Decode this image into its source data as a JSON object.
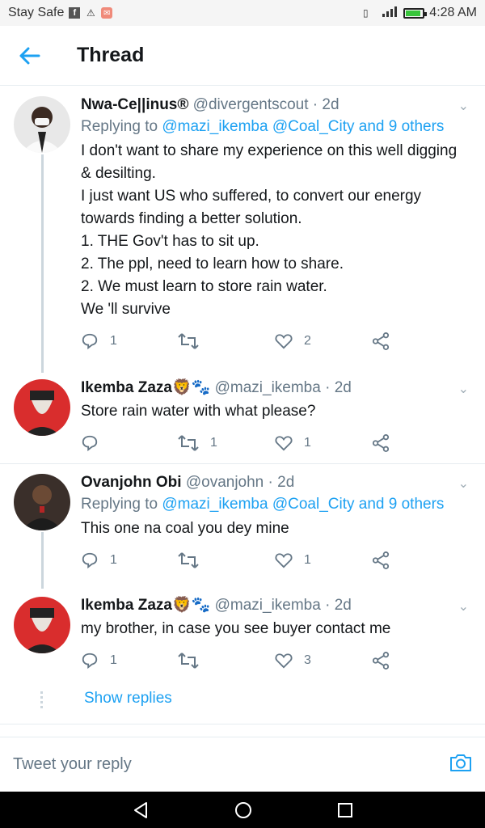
{
  "statusbar": {
    "left_text": "Stay Safe",
    "time": "4:28 AM"
  },
  "header": {
    "title": "Thread"
  },
  "tweets": [
    {
      "name": "Nwa-Ce||inus®",
      "handle": "@divergentscout · 2d",
      "replying_prefix": "Replying to ",
      "replying_links": "@mazi_ikemba @Coal_City and 9 others",
      "text": "I don't want to share my experience on this well digging & desilting.\nI just want US who suffered, to convert our energy towards finding a better solution.\n1. THE Gov't has to sit up.\n2. The ppl, need to learn how to share.\n2. We must learn to store rain water.\nWe 'll survive",
      "replies": "1",
      "retweets": "",
      "likes": "2"
    },
    {
      "name": "Ikemba Zaza🦁🐾",
      "handle": "@mazi_ikemba · 2d",
      "text": "Store rain water with what please?",
      "replies": "",
      "retweets": "1",
      "likes": "1"
    },
    {
      "name": "Ovanjohn Obi",
      "handle": "@ovanjohn · 2d",
      "replying_prefix": "Replying to ",
      "replying_links": "@mazi_ikemba @Coal_City and 9 others",
      "text": "This one na coal you dey mine",
      "replies": "1",
      "retweets": "",
      "likes": "1"
    },
    {
      "name": "Ikemba Zaza🦁🐾",
      "handle": "@mazi_ikemba · 2d",
      "text": "my brother, in case you see buyer contact me",
      "replies": "1",
      "retweets": "",
      "likes": "3"
    }
  ],
  "show_replies": "Show replies",
  "reply_box": {
    "placeholder": "Tweet your reply"
  },
  "colors": {
    "accent": "#1da1f2",
    "muted": "#657786"
  }
}
